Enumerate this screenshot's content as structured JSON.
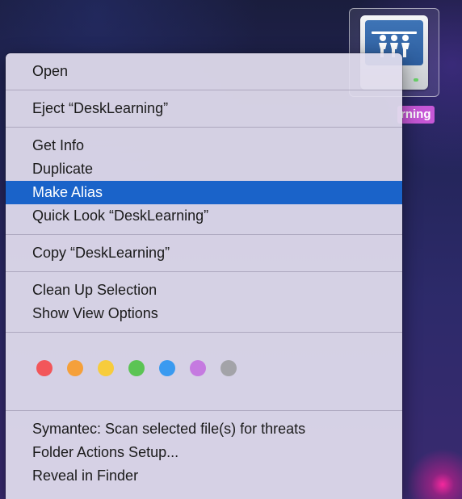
{
  "desktop": {
    "drive": {
      "icon": "network-drive-icon",
      "label_visible": "rning"
    }
  },
  "menu": {
    "group1": [
      {
        "label": "Open"
      }
    ],
    "group2": [
      {
        "label": "Eject “DeskLearning”"
      }
    ],
    "group3": [
      {
        "label": "Get Info"
      },
      {
        "label": "Duplicate"
      },
      {
        "label": "Make Alias",
        "selected": true
      },
      {
        "label": "Quick Look “DeskLearning”"
      }
    ],
    "group4": [
      {
        "label": "Copy “DeskLearning”"
      }
    ],
    "group5": [
      {
        "label": "Clean Up Selection"
      },
      {
        "label": "Show View Options"
      }
    ],
    "tags": [
      {
        "name": "red",
        "color": "#f2565a"
      },
      {
        "name": "orange",
        "color": "#f5a03a"
      },
      {
        "name": "yellow",
        "color": "#f7cc3c"
      },
      {
        "name": "green",
        "color": "#5bc454"
      },
      {
        "name": "blue",
        "color": "#3a9af0"
      },
      {
        "name": "purple",
        "color": "#c57ae0"
      },
      {
        "name": "gray",
        "color": "#a3a3a8"
      }
    ],
    "group6": [
      {
        "label": "Symantec: Scan selected file(s) for threats"
      },
      {
        "label": "Folder Actions Setup..."
      },
      {
        "label": "Reveal in Finder"
      }
    ]
  },
  "colors": {
    "selection": "#1a63c9",
    "label_highlight": "#c657d6"
  }
}
